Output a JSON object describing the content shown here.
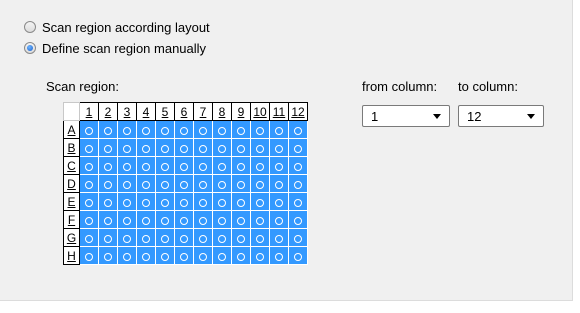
{
  "scan_options": {
    "layout_label": "Scan region according layout",
    "manual_label": "Define scan region manually"
  },
  "scan_region": {
    "label": "Scan region:",
    "columns": [
      "1",
      "2",
      "3",
      "4",
      "5",
      "6",
      "7",
      "8",
      "9",
      "10",
      "11",
      "12"
    ],
    "rows": [
      "A",
      "B",
      "C",
      "D",
      "E",
      "F",
      "G",
      "H"
    ],
    "selected_color": "#3399ff"
  },
  "column_range": {
    "from_label": "from column:",
    "to_label": "to column:",
    "from_value": "1",
    "to_value": "12"
  }
}
